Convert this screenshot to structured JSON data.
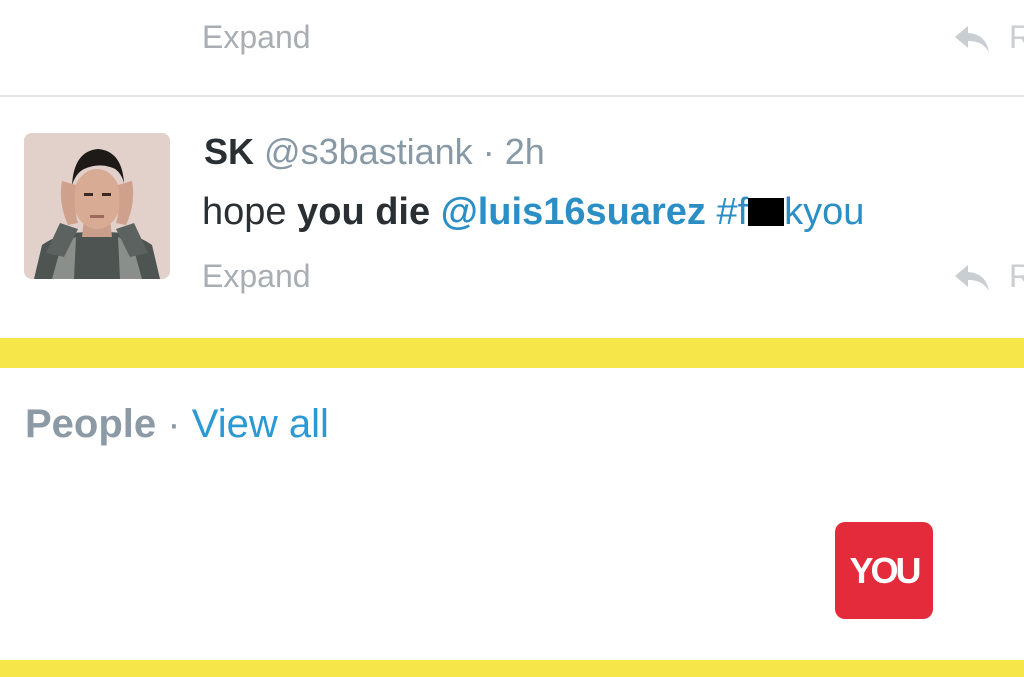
{
  "previous_tweet": {
    "expand_label": "Expand",
    "reply_label": "R"
  },
  "tweet": {
    "fullname": "SK",
    "username": "@s3bastiank",
    "separator": "·",
    "time": "2h",
    "text_plain_1": "hope ",
    "text_bold": "you die",
    "mention": "@luis16suarez",
    "hashtag_start": "#f",
    "hashtag_end": "kyou",
    "expand_label": "Expand",
    "reply_label": "R"
  },
  "people": {
    "title": "People",
    "separator": "·",
    "view_all_label": "View all"
  },
  "badge": {
    "text": "YOU"
  },
  "colors": {
    "highlight_bar": "#f6e649",
    "link": "#2b8fc6",
    "badge_bg": "#e32b3c",
    "muted_text": "#8899a6"
  }
}
